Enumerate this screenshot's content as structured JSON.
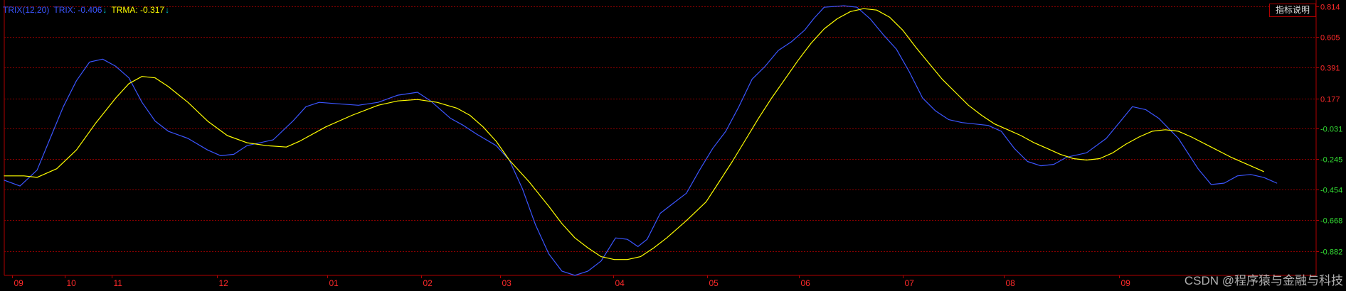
{
  "legend": {
    "indicator": "TRIX(12,20)",
    "trix_label": "TRIX: -0.406",
    "trma_label": "TRMA: -0.317",
    "down_arrow": "↓"
  },
  "help_button": {
    "label": "指标说明"
  },
  "watermark": "CSDN @程序猿与金融与科技",
  "colors": {
    "background": "#000000",
    "grid": "#8b0000",
    "axis": "#b00000",
    "trix": "#3b55ff",
    "trma": "#ffff00",
    "x_label": "#ff2a2a",
    "y_label_positive": "#ff2a2a",
    "y_label_negative": "#33dd33",
    "arrow": "#00c8c8"
  },
  "chart_data": {
    "type": "line",
    "title": "TRIX(12,20)",
    "grid": true,
    "legend_position": "top-left",
    "ylim": [
      -1.05,
      0.86
    ],
    "xlim": [
      0,
      100
    ],
    "y_ticks": [
      0.814,
      0.605,
      0.391,
      0.177,
      -0.031,
      -0.245,
      -0.454,
      -0.668,
      -0.882
    ],
    "y_tick_labels": [
      "0.814",
      "0.605",
      "0.391",
      "0.177",
      "-0.031",
      "-0.245",
      "-0.454",
      "-0.668",
      "-0.882"
    ],
    "x_ticks": [
      {
        "label": "09",
        "x": 0.6
      },
      {
        "label": "10",
        "x": 4.6
      },
      {
        "label": "11",
        "x": 8.2
      },
      {
        "label": "12",
        "x": 16.2
      },
      {
        "label": "01",
        "x": 24.6
      },
      {
        "label": "02",
        "x": 31.8
      },
      {
        "label": "03",
        "x": 37.8
      },
      {
        "label": "04",
        "x": 46.4
      },
      {
        "label": "05",
        "x": 53.6
      },
      {
        "label": "06",
        "x": 60.6
      },
      {
        "label": "07",
        "x": 68.5
      },
      {
        "label": "08",
        "x": 76.2
      },
      {
        "label": "09",
        "x": 85.0
      }
    ],
    "series": [
      {
        "name": "TRIX",
        "color": "#3b55ff",
        "points": [
          [
            0.0,
            -0.39
          ],
          [
            1.2,
            -0.43
          ],
          [
            2.5,
            -0.32
          ],
          [
            3.5,
            -0.1
          ],
          [
            4.5,
            0.12
          ],
          [
            5.5,
            0.3
          ],
          [
            6.5,
            0.43
          ],
          [
            7.5,
            0.45
          ],
          [
            8.5,
            0.4
          ],
          [
            9.5,
            0.32
          ],
          [
            10.5,
            0.15
          ],
          [
            11.5,
            0.02
          ],
          [
            12.5,
            -0.05
          ],
          [
            14.0,
            -0.1
          ],
          [
            15.5,
            -0.18
          ],
          [
            16.5,
            -0.22
          ],
          [
            17.5,
            -0.21
          ],
          [
            18.5,
            -0.15
          ],
          [
            20.5,
            -0.11
          ],
          [
            22.0,
            0.02
          ],
          [
            23.0,
            0.12
          ],
          [
            24.0,
            0.15
          ],
          [
            25.5,
            0.14
          ],
          [
            27.0,
            0.13
          ],
          [
            28.5,
            0.15
          ],
          [
            30.0,
            0.2
          ],
          [
            31.5,
            0.22
          ],
          [
            32.5,
            0.16
          ],
          [
            34.0,
            0.04
          ],
          [
            35.0,
            -0.01
          ],
          [
            36.0,
            -0.07
          ],
          [
            37.5,
            -0.15
          ],
          [
            38.5,
            -0.25
          ],
          [
            39.5,
            -0.45
          ],
          [
            40.5,
            -0.7
          ],
          [
            41.5,
            -0.9
          ],
          [
            42.5,
            -1.02
          ],
          [
            43.5,
            -1.05
          ],
          [
            44.5,
            -1.02
          ],
          [
            45.5,
            -0.95
          ],
          [
            46.6,
            -0.79
          ],
          [
            47.5,
            -0.8
          ],
          [
            48.3,
            -0.85
          ],
          [
            49.0,
            -0.8
          ],
          [
            50.0,
            -0.62
          ],
          [
            51.0,
            -0.55
          ],
          [
            52.0,
            -0.48
          ],
          [
            53.0,
            -0.32
          ],
          [
            54.0,
            -0.17
          ],
          [
            55.0,
            -0.05
          ],
          [
            56.0,
            0.12
          ],
          [
            57.0,
            0.31
          ],
          [
            58.0,
            0.4
          ],
          [
            59.0,
            0.51
          ],
          [
            60.0,
            0.57
          ],
          [
            61.0,
            0.65
          ],
          [
            61.7,
            0.73
          ],
          [
            62.5,
            0.81
          ],
          [
            64.0,
            0.82
          ],
          [
            65.0,
            0.81
          ],
          [
            66.0,
            0.73
          ],
          [
            67.0,
            0.62
          ],
          [
            68.0,
            0.52
          ],
          [
            69.0,
            0.36
          ],
          [
            70.0,
            0.18
          ],
          [
            71.0,
            0.09
          ],
          [
            72.0,
            0.03
          ],
          [
            73.0,
            0.01
          ],
          [
            75.0,
            -0.01
          ],
          [
            76.0,
            -0.05
          ],
          [
            77.0,
            -0.17
          ],
          [
            78.0,
            -0.26
          ],
          [
            79.0,
            -0.29
          ],
          [
            80.0,
            -0.28
          ],
          [
            81.0,
            -0.23
          ],
          [
            82.5,
            -0.2
          ],
          [
            84.0,
            -0.1
          ],
          [
            85.0,
            0.01
          ],
          [
            86.0,
            0.12
          ],
          [
            87.0,
            0.1
          ],
          [
            88.0,
            0.04
          ],
          [
            89.5,
            -0.1
          ],
          [
            91.0,
            -0.31
          ],
          [
            92.0,
            -0.42
          ],
          [
            93.0,
            -0.41
          ],
          [
            94.0,
            -0.36
          ],
          [
            95.0,
            -0.35
          ],
          [
            96.0,
            -0.37
          ],
          [
            97.0,
            -0.41
          ]
        ]
      },
      {
        "name": "TRMA",
        "color": "#ffff00",
        "points": [
          [
            0.0,
            -0.36
          ],
          [
            1.5,
            -0.36
          ],
          [
            2.5,
            -0.37
          ],
          [
            4.0,
            -0.31
          ],
          [
            5.5,
            -0.18
          ],
          [
            7.0,
            0.01
          ],
          [
            8.5,
            0.18
          ],
          [
            9.5,
            0.28
          ],
          [
            10.5,
            0.33
          ],
          [
            11.5,
            0.32
          ],
          [
            12.5,
            0.26
          ],
          [
            14.0,
            0.15
          ],
          [
            15.5,
            0.02
          ],
          [
            17.0,
            -0.08
          ],
          [
            18.5,
            -0.13
          ],
          [
            20.0,
            -0.15
          ],
          [
            21.5,
            -0.16
          ],
          [
            22.5,
            -0.12
          ],
          [
            24.5,
            -0.02
          ],
          [
            26.5,
            0.06
          ],
          [
            28.5,
            0.13
          ],
          [
            30.0,
            0.16
          ],
          [
            31.5,
            0.17
          ],
          [
            33.0,
            0.15
          ],
          [
            34.5,
            0.11
          ],
          [
            35.5,
            0.06
          ],
          [
            36.5,
            -0.02
          ],
          [
            37.5,
            -0.12
          ],
          [
            38.5,
            -0.25
          ],
          [
            40.0,
            -0.4
          ],
          [
            41.5,
            -0.57
          ],
          [
            42.5,
            -0.69
          ],
          [
            43.5,
            -0.79
          ],
          [
            44.5,
            -0.86
          ],
          [
            45.5,
            -0.92
          ],
          [
            46.5,
            -0.94
          ],
          [
            47.5,
            -0.94
          ],
          [
            48.5,
            -0.92
          ],
          [
            49.5,
            -0.86
          ],
          [
            50.5,
            -0.79
          ],
          [
            52.0,
            -0.67
          ],
          [
            53.5,
            -0.54
          ],
          [
            54.5,
            -0.4
          ],
          [
            55.5,
            -0.26
          ],
          [
            56.5,
            -0.11
          ],
          [
            57.5,
            0.04
          ],
          [
            58.5,
            0.18
          ],
          [
            59.5,
            0.31
          ],
          [
            60.5,
            0.44
          ],
          [
            61.5,
            0.56
          ],
          [
            62.5,
            0.66
          ],
          [
            63.5,
            0.73
          ],
          [
            64.5,
            0.78
          ],
          [
            65.5,
            0.8
          ],
          [
            66.5,
            0.79
          ],
          [
            67.5,
            0.74
          ],
          [
            68.5,
            0.65
          ],
          [
            69.5,
            0.53
          ],
          [
            70.5,
            0.42
          ],
          [
            71.5,
            0.31
          ],
          [
            72.5,
            0.22
          ],
          [
            73.5,
            0.13
          ],
          [
            74.5,
            0.06
          ],
          [
            75.5,
            0.0
          ],
          [
            76.5,
            -0.04
          ],
          [
            77.5,
            -0.08
          ],
          [
            78.5,
            -0.13
          ],
          [
            79.5,
            -0.17
          ],
          [
            80.5,
            -0.21
          ],
          [
            81.5,
            -0.24
          ],
          [
            82.5,
            -0.25
          ],
          [
            83.5,
            -0.24
          ],
          [
            84.5,
            -0.2
          ],
          [
            85.5,
            -0.14
          ],
          [
            86.5,
            -0.09
          ],
          [
            87.5,
            -0.05
          ],
          [
            88.5,
            -0.04
          ],
          [
            89.5,
            -0.05
          ],
          [
            90.5,
            -0.09
          ],
          [
            92.0,
            -0.16
          ],
          [
            93.5,
            -0.23
          ],
          [
            95.0,
            -0.29
          ],
          [
            96.0,
            -0.33
          ]
        ]
      }
    ]
  }
}
